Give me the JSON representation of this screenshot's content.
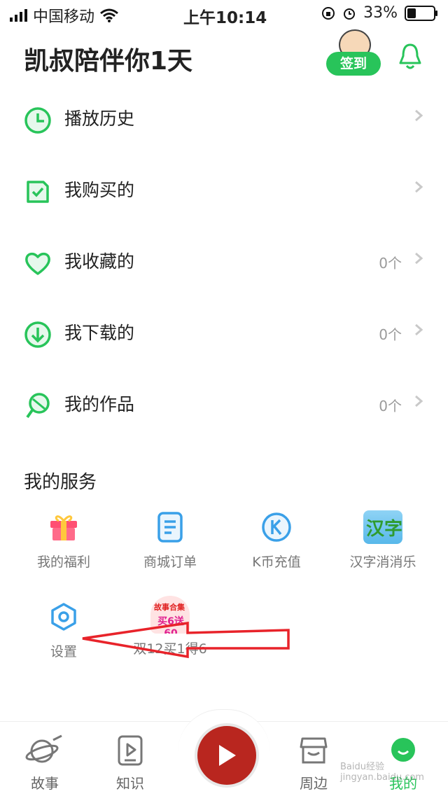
{
  "status": {
    "carrier": "中国移动",
    "time": "上午10:14",
    "battery": "33%"
  },
  "header": {
    "title": "凯叔陪伴你1天",
    "sign_label": "签到"
  },
  "menu": [
    {
      "label": "播放历史",
      "count": ""
    },
    {
      "label": "我购买的",
      "count": ""
    },
    {
      "label": "我收藏的",
      "count": "0个"
    },
    {
      "label": "我下载的",
      "count": "0个"
    },
    {
      "label": "我的作品",
      "count": "0个"
    }
  ],
  "services": {
    "title": "我的服务",
    "items": [
      {
        "label": "我的福利"
      },
      {
        "label": "商城订单"
      },
      {
        "label": "K币充值"
      },
      {
        "label": "汉字消消乐",
        "badge_text": "汉字"
      },
      {
        "label": "设置"
      },
      {
        "label": "双12买1得6",
        "badge_top": "故事合集",
        "badge_main": "买6送60"
      }
    ]
  },
  "nav": [
    {
      "label": "故事"
    },
    {
      "label": "知识"
    },
    {
      "label": "周边"
    },
    {
      "label": "我的"
    }
  ],
  "watermark": "Baidu经验 jingyan.baidu.com",
  "colors": {
    "accent": "#28c45a",
    "annotation": "#e8232a"
  }
}
